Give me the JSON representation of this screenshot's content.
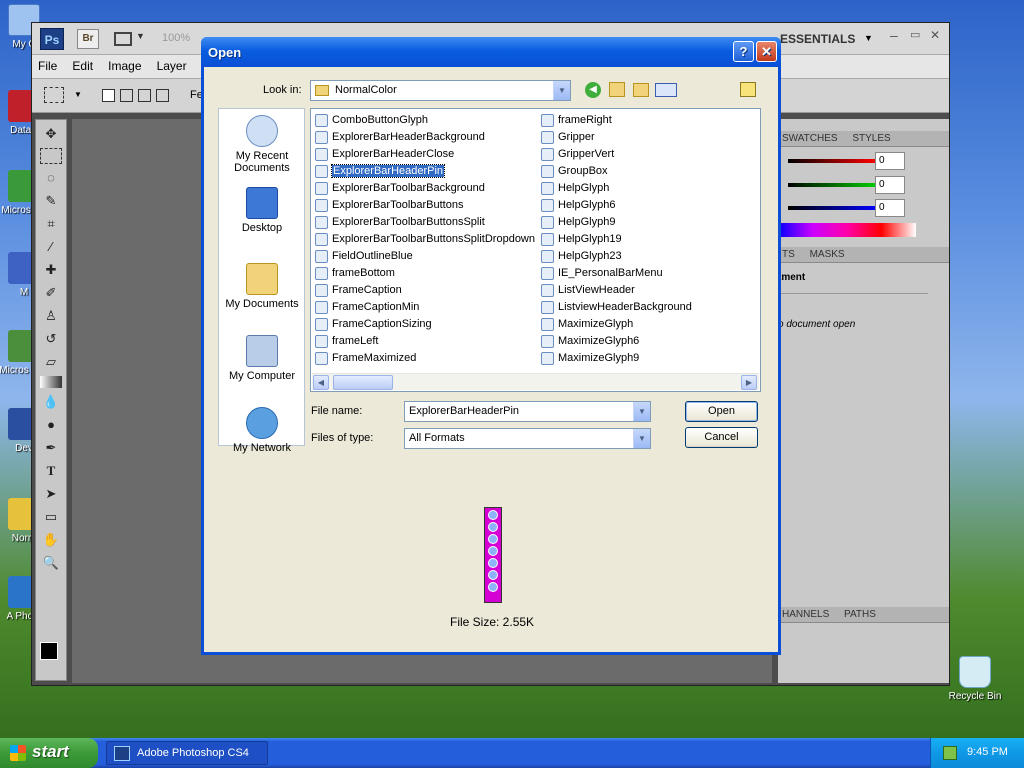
{
  "desktop": {
    "icons": [
      {
        "label": "My C",
        "icon": "my-computer-icon"
      },
      {
        "label": "DataV",
        "icon": "data-icon"
      },
      {
        "label": "Micros C+",
        "icon": "ms-icon"
      },
      {
        "label": "M",
        "icon": "m-icon"
      },
      {
        "label": "Micros Bas",
        "icon": "ms-basic-icon"
      },
      {
        "label": "Dev",
        "icon": "dev-icon"
      },
      {
        "label": "Norm",
        "icon": "norm-icon"
      },
      {
        "label": "A Photo",
        "icon": "photoshop-shortcut-icon"
      }
    ],
    "recycle_bin": "Recycle Bin"
  },
  "photoshop": {
    "logo": "Ps",
    "bridge": "Br",
    "zoom": "100%",
    "workspace": "ESSENTIALS",
    "menu": [
      "File",
      "Edit",
      "Image",
      "Layer"
    ],
    "options_label": "Fe",
    "panels": {
      "swatches_tab": "SWATCHES",
      "styles_tab": "STYLES",
      "rgb_values": [
        "0",
        "0",
        "0"
      ],
      "adjustments_tab": "TS",
      "masks_tab": "MASKS",
      "adjustment_title": "tment",
      "no_document": "o document open",
      "channels_tab": "HANNELS",
      "paths_tab": "PATHS"
    }
  },
  "dialog": {
    "title": "Open",
    "help_btn": "?",
    "close_btn": "✕",
    "look_in_label": "Look in:",
    "look_in_value": "NormalColor",
    "places": [
      {
        "label": "My Recent Documents",
        "icon": "recent-documents-icon"
      },
      {
        "label": "Desktop",
        "icon": "desktop-icon"
      },
      {
        "label": "My Documents",
        "icon": "my-documents-icon"
      },
      {
        "label": "My Computer",
        "icon": "my-computer-icon"
      },
      {
        "label": "My Network",
        "icon": "my-network-icon"
      }
    ],
    "files_col1": [
      "ComboButtonGlyph",
      "ExplorerBarHeaderBackground",
      "ExplorerBarHeaderClose",
      "ExplorerBarHeaderPin",
      "ExplorerBarToolbarBackground",
      "ExplorerBarToolbarButtons",
      "ExplorerBarToolbarButtonsSplit",
      "ExplorerBarToolbarButtonsSplitDropdown",
      "FieldOutlineBlue",
      "frameBottom",
      "FrameCaption",
      "FrameCaptionMin",
      "FrameCaptionSizing",
      "frameLeft",
      "FrameMaximized"
    ],
    "files_col2": [
      "frameRight",
      "Gripper",
      "GripperVert",
      "GroupBox",
      "HelpGlyph",
      "HelpGlyph6",
      "HelpGlyph9",
      "HelpGlyph19",
      "HelpGlyph23",
      "IE_PersonalBarMenu",
      "ListViewHeader",
      "ListviewHeaderBackground",
      "MaximizeGlyph",
      "MaximizeGlyph6",
      "MaximizeGlyph9"
    ],
    "selected_file": "ExplorerBarHeaderPin",
    "file_name_label": "File name:",
    "file_name_value": "ExplorerBarHeaderPin",
    "file_type_label": "Files of type:",
    "file_type_value": "All Formats",
    "open_button": "Open",
    "cancel_button": "Cancel",
    "file_size": "File Size: 2.55K"
  },
  "taskbar": {
    "start": "start",
    "task": "Adobe Photoshop CS4",
    "clock": "9:45 PM"
  }
}
